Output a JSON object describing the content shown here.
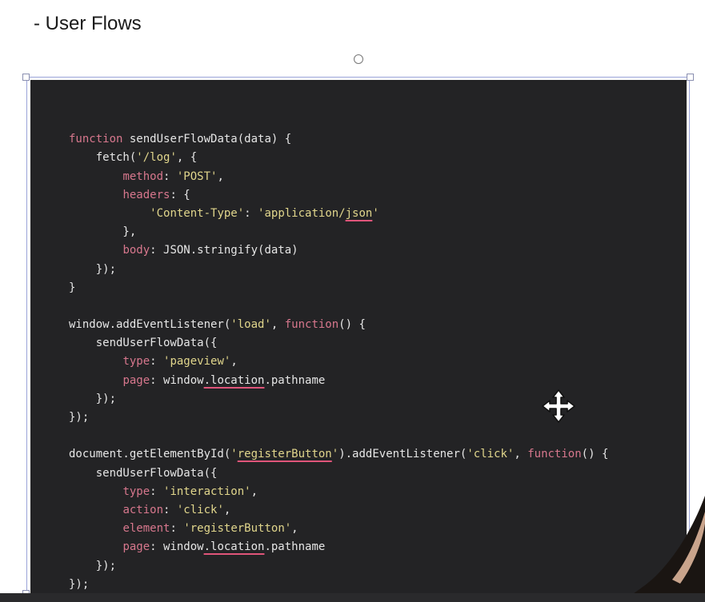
{
  "page": {
    "heading": "- User Flows"
  },
  "code": {
    "lines": [
      "",
      "function sendUserFlowData(data) {",
      "    fetch('/log', {",
      "        method: 'POST',",
      "        headers: {",
      "            'Content-Type': 'application/json'",
      "        },",
      "        body: JSON.stringify(data)",
      "    });",
      "}",
      "",
      "window.addEventListener('load', function() {",
      "    sendUserFlowData({",
      "        type: 'pageview',",
      "        page: window.location.pathname",
      "    });",
      "});",
      "",
      "document.getElementById('registerButton').addEventListener('click', function() {",
      "    sendUserFlowData({",
      "        type: 'interaction',",
      "        action: 'click',",
      "        element: 'registerButton',",
      "        page: window.location.pathname",
      "    });",
      "});"
    ]
  },
  "colors": {
    "code_background": "#232325",
    "keyword": "#d7778d",
    "string": "#e1d68c",
    "plain": "#e8e8e8",
    "squiggle": "#e0557a",
    "selection_border": "#9aa3d8"
  },
  "icons": {
    "cursor": "move-cursor-icon",
    "rotate": "rotate-handle-icon"
  }
}
